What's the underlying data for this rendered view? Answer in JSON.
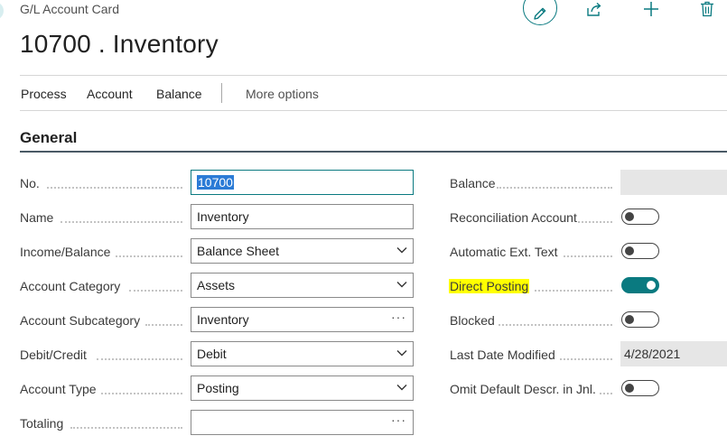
{
  "header": {
    "breadcrumb": "G/L Account Card",
    "title": "10700 . Inventory"
  },
  "actions": {
    "menu": [
      "Process",
      "Account",
      "Balance"
    ],
    "more_options": "More options"
  },
  "section": {
    "title": "General"
  },
  "left_fields": [
    {
      "label": "No.",
      "value": "10700",
      "control": "text",
      "focused": true
    },
    {
      "label": "Name",
      "value": "Inventory",
      "control": "text"
    },
    {
      "label": "Income/Balance",
      "value": "Balance Sheet",
      "control": "dropdown"
    },
    {
      "label": "Account Category",
      "value": "Assets",
      "control": "dropdown"
    },
    {
      "label": "Account Subcategory",
      "value": "Inventory",
      "control": "lookup"
    },
    {
      "label": "Debit/Credit",
      "value": "Debit",
      "control": "dropdown"
    },
    {
      "label": "Account Type",
      "value": "Posting",
      "control": "dropdown"
    },
    {
      "label": "Totaling",
      "value": "",
      "control": "lookup"
    }
  ],
  "right_fields": [
    {
      "label": "Balance",
      "value": "",
      "control": "readonly"
    },
    {
      "label": "Reconciliation Account",
      "value": false,
      "control": "toggle"
    },
    {
      "label": "Automatic Ext. Text",
      "value": false,
      "control": "toggle"
    },
    {
      "label": "Direct Posting",
      "value": true,
      "control": "toggle",
      "highlighted": true
    },
    {
      "label": "Blocked",
      "value": false,
      "control": "toggle"
    },
    {
      "label": "Last Date Modified",
      "value": "4/28/2021",
      "control": "readonly"
    },
    {
      "label": "Omit Default Descr. in Jnl.",
      "value": false,
      "control": "toggle"
    }
  ],
  "colors": {
    "accent": "#0a7a80",
    "highlight": "#ffff00",
    "selection": "#2b7bd6",
    "readonly_bg": "#e6e6e6"
  },
  "icons": [
    "edit-pencil-icon",
    "share-icon",
    "add-icon",
    "delete-trash-icon",
    "chevron-down-icon",
    "ellipsis-icon"
  ]
}
